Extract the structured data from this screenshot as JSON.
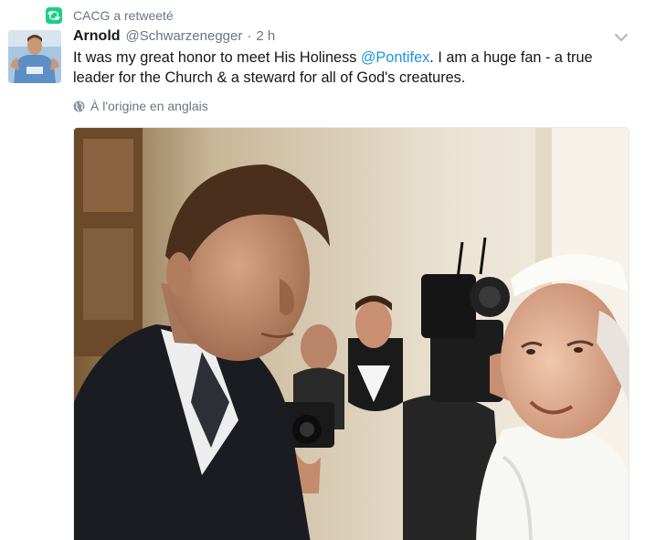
{
  "retweet": {
    "text": "CACG a retweeté",
    "icon": "retweet-icon",
    "color": "#19cf86"
  },
  "author": {
    "name": "Arnold",
    "handle": "@Schwarzenegger",
    "separator": "·",
    "time": "2 h",
    "avatar": "avatar-photo"
  },
  "tweet": {
    "text_before": "It was my great honor to meet His Holiness ",
    "mention": "@Pontifex",
    "text_after": ". I am a huge fan - a true leader for the Church & a steward for all of God's creatures.",
    "mention_color": "#1b95e0"
  },
  "translation": {
    "label": "À l'origine en anglais",
    "icon": "globe-icon"
  },
  "menu": {
    "icon": "chevron-down-icon"
  },
  "media": {
    "type": "photo"
  }
}
